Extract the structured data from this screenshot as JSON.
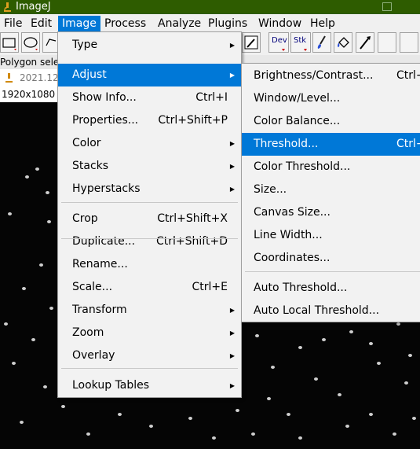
{
  "window": {
    "title": "ImageJ"
  },
  "menubar": [
    "File",
    "Edit",
    "Image",
    "Process",
    "Analyze",
    "Plugins",
    "Window",
    "Help"
  ],
  "toolbar": {
    "dev_label": "Dev",
    "stk_label": "Stk"
  },
  "status": {
    "text": "Polygon sele"
  },
  "image_window": {
    "title": "2021.12.",
    "info": "1920x1080 p"
  },
  "image_menu": {
    "items": [
      {
        "label": "Type",
        "shortcut": "",
        "submenu": true
      },
      {
        "label": "Adjust",
        "shortcut": "",
        "submenu": true
      },
      {
        "label": "Show Info...",
        "shortcut": "Ctrl+I",
        "submenu": false
      },
      {
        "label": "Properties...",
        "shortcut": "Ctrl+Shift+P",
        "submenu": false
      },
      {
        "label": "Color",
        "shortcut": "",
        "submenu": true
      },
      {
        "label": "Stacks",
        "shortcut": "",
        "submenu": true
      },
      {
        "label": "Hyperstacks",
        "shortcut": "",
        "submenu": true
      },
      {
        "label": "Crop",
        "shortcut": "Ctrl+Shift+X",
        "submenu": false
      },
      {
        "label": "Duplicate...",
        "shortcut": "Ctrl+Shift+D",
        "submenu": false
      },
      {
        "label": "Rename...",
        "shortcut": "",
        "submenu": false
      },
      {
        "label": "Scale...",
        "shortcut": "Ctrl+E",
        "submenu": false
      },
      {
        "label": "Transform",
        "shortcut": "",
        "submenu": true
      },
      {
        "label": "Zoom",
        "shortcut": "",
        "submenu": true
      },
      {
        "label": "Overlay",
        "shortcut": "",
        "submenu": true
      },
      {
        "label": "Lookup Tables",
        "shortcut": "",
        "submenu": true
      }
    ]
  },
  "adjust_menu": {
    "items": [
      {
        "label": "Brightness/Contrast...",
        "shortcut": "Ctrl+"
      },
      {
        "label": "Window/Level...",
        "shortcut": ""
      },
      {
        "label": "Color Balance...",
        "shortcut": ""
      },
      {
        "label": "Threshold...",
        "shortcut": "Ctrl+"
      },
      {
        "label": "Color Threshold...",
        "shortcut": ""
      },
      {
        "label": "Size...",
        "shortcut": ""
      },
      {
        "label": "Canvas Size...",
        "shortcut": ""
      },
      {
        "label": "Line Width...",
        "shortcut": ""
      },
      {
        "label": "Coordinates...",
        "shortcut": ""
      },
      {
        "label": "Auto Threshold...",
        "shortcut": ""
      },
      {
        "label": "Auto Local Threshold...",
        "shortcut": ""
      }
    ]
  }
}
